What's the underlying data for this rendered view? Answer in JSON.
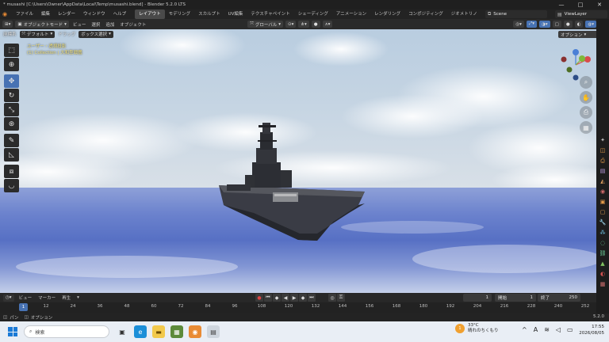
{
  "window": {
    "title": "* musashi [C:\\Users\\Owner\\AppData\\Local\\Temp\\musashi.blend] - Blender 5.2.0 LTS",
    "controls": [
      "—",
      "□",
      "✕"
    ]
  },
  "menubar": {
    "items": [
      "ファイル",
      "編集",
      "レンダー",
      "ウィンドウ",
      "ヘルプ"
    ],
    "workspaces": [
      "レイアウト",
      "モデリング",
      "スカルプト",
      "UV編集",
      "テクスチャペイント",
      "シェーディング",
      "アニメーション",
      "レンダリング",
      "コンポジティング",
      "ジオメトリノ"
    ],
    "active_workspace": 0,
    "scene": "Scene",
    "view_layer": "ViewLayer"
  },
  "header": {
    "mode": "オブジェクトモード",
    "menus": [
      "ビュー",
      "選択",
      "追加",
      "オブジェクト"
    ],
    "transform_orientation": "グローバル",
    "options": "オプション"
  },
  "toolsettings": {
    "coord_label": "座標系",
    "orientation": "デフォルト",
    "drag_label": "ドラッグ",
    "select_mode": "ボックス選択"
  },
  "viewport": {
    "view_name": "ユーザー・透視投影",
    "collection_info": "(1) Collection | 大和型戦艦"
  },
  "timeline": {
    "menus": [
      "ビュー",
      "マーカー",
      "再生"
    ],
    "current_frame": "1",
    "start_label": "開始",
    "start": "1",
    "end_label": "終了",
    "end": "250",
    "ticks": [
      "12",
      "24",
      "36",
      "48",
      "60",
      "72",
      "84",
      "96",
      "108",
      "120",
      "132",
      "144",
      "156",
      "168",
      "180",
      "192",
      "204",
      "216",
      "228",
      "240",
      "252"
    ]
  },
  "statusbar": {
    "pan": "パン",
    "options": "オプション",
    "version": "5.2.0"
  },
  "taskbar": {
    "search_placeholder": "検索",
    "weather_temp": "33°C",
    "weather_desc": "晴れのちくもり",
    "weather_badge": "1",
    "time": "17:55",
    "date": "2026/08/05",
    "ime": "A"
  },
  "colors": {
    "accent": "#4772b3",
    "blender_orange": "#e98b34",
    "overlay_text": "#f0e07a",
    "axis_x": "#d94b4b",
    "axis_y": "#7fb83a",
    "axis_z": "#4a7fd6"
  }
}
